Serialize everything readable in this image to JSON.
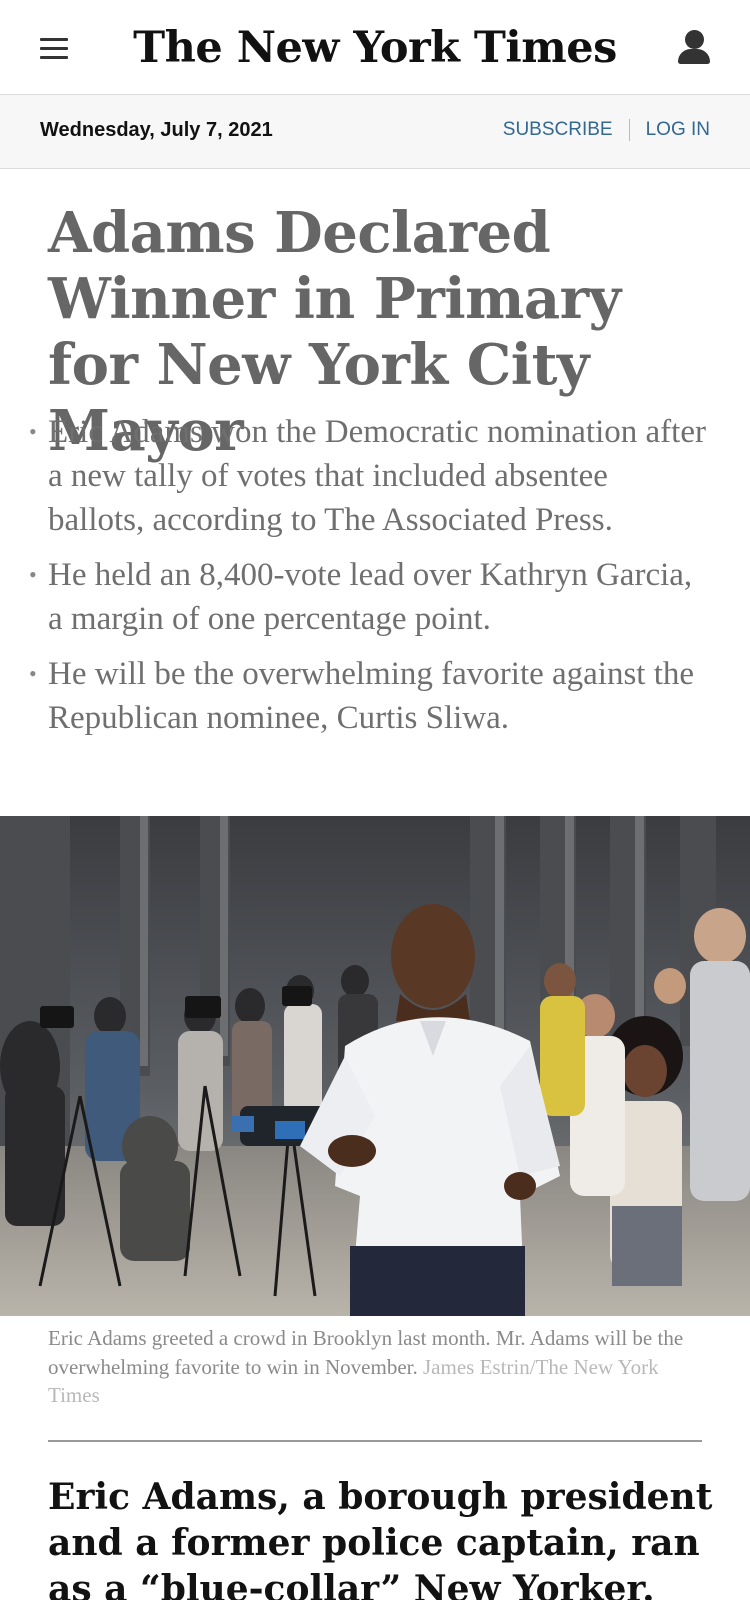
{
  "header": {
    "masthead": "The New York Times",
    "menu_icon": "hamburger-menu-icon",
    "account_icon": "user-account-icon"
  },
  "datebar": {
    "date": "Wednesday, July 7, 2021",
    "subscribe_label": "SUBSCRIBE",
    "login_label": "LOG IN"
  },
  "article": {
    "headline": "Adams Declared Winner in Primary for New York City Mayor",
    "summary": [
      "Eric Adams won the Democratic nomination after a new tally of votes that included absentee ballots, according to The Associated Press.",
      "He held an 8,400-vote lead over Kathryn Garcia, a margin of one percentage point.",
      "He will be the overwhelming favorite against the Republican nominee, Curtis Sliwa."
    ],
    "photo": {
      "caption": "Eric Adams greeted a crowd in Brooklyn last month. Mr. Adams will be the overwhelming favorite to win in November.",
      "credit": "James Estrin/The New York Times"
    },
    "lede": "Eric Adams, a borough president and a former police captain, ran as a “blue-collar” New Yorker."
  },
  "colors": {
    "link_blue": "#326891",
    "headline_gray": "#666666",
    "summary_gray": "#6f6f6f",
    "date_bar_bg": "#f7f7f7"
  }
}
